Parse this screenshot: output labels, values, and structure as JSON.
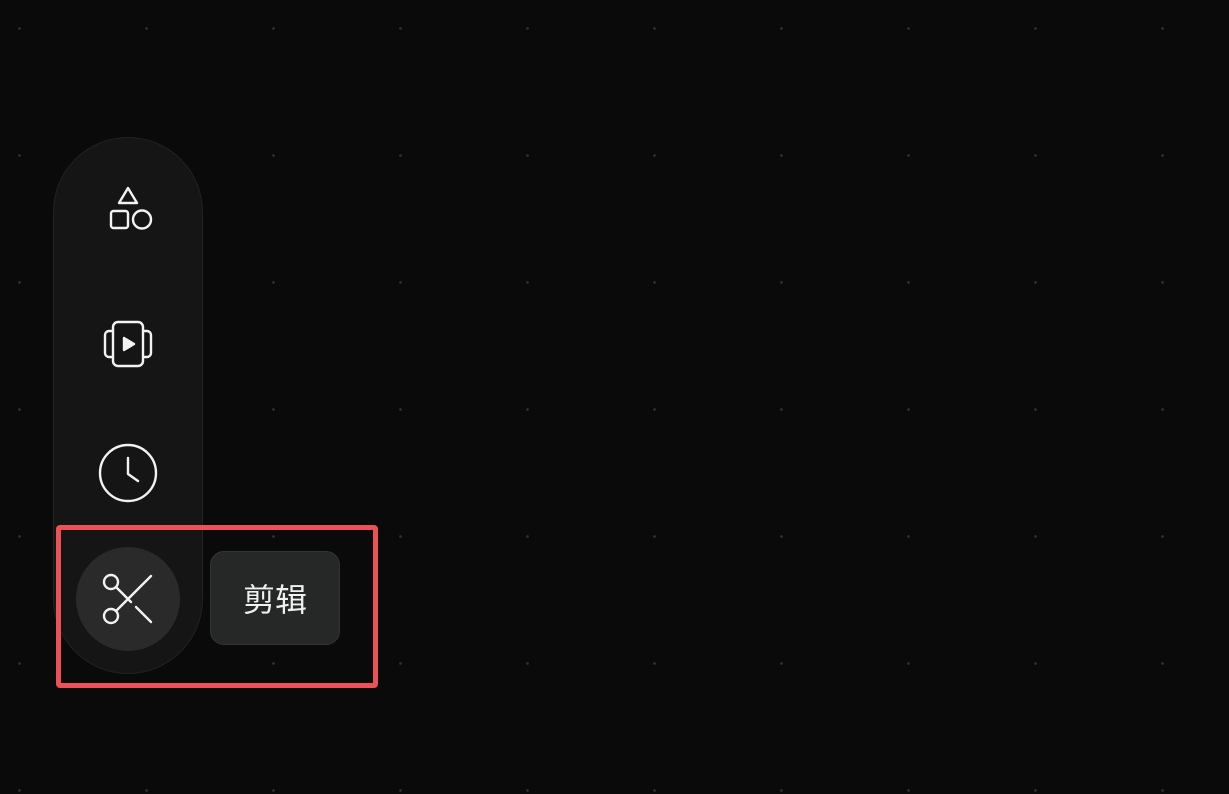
{
  "toolbar": {
    "items": [
      {
        "icon": "shapes-icon",
        "active": false
      },
      {
        "icon": "video-play-icon",
        "active": false
      },
      {
        "icon": "clock-icon",
        "active": false
      },
      {
        "icon": "scissors-icon",
        "active": true
      }
    ]
  },
  "tooltip": {
    "label": "剪辑"
  },
  "colors": {
    "background": "#0a0a0a",
    "toolbar": "#151515",
    "active_item": "#2a2a2a",
    "highlight": "#ec5158",
    "icon": "#f2f2f2"
  }
}
